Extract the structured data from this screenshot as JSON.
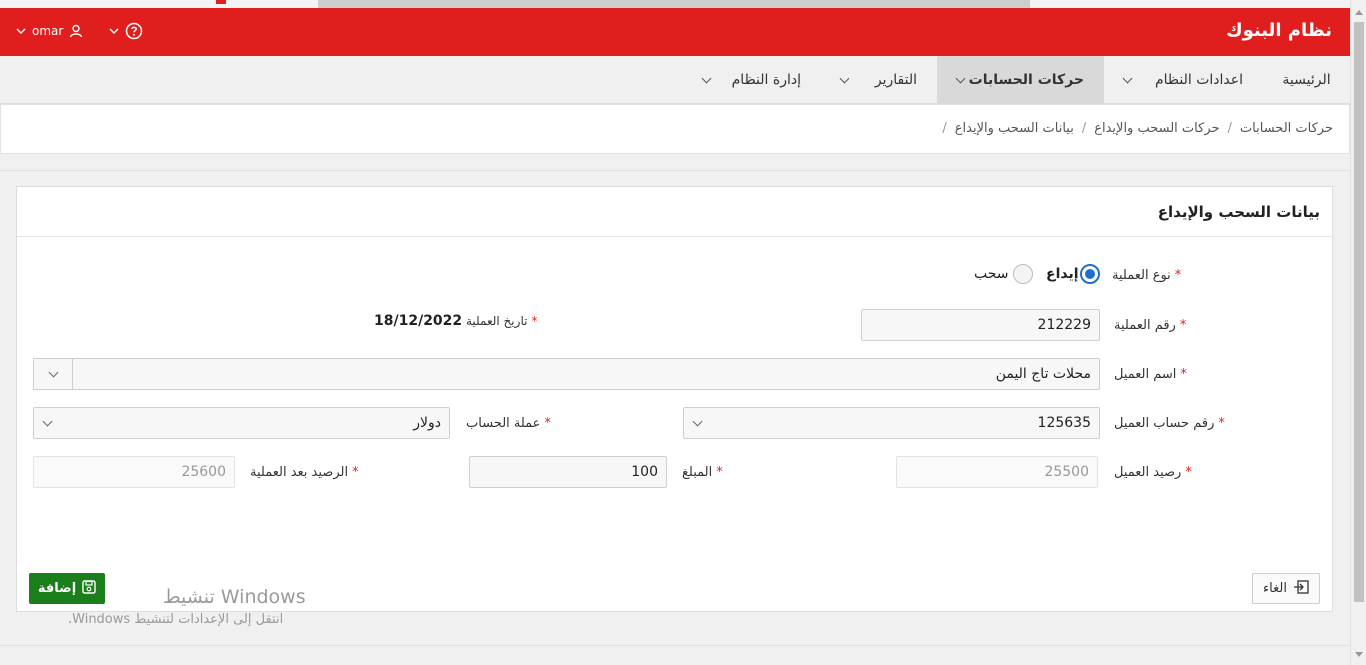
{
  "app": {
    "title": "نظام البنوك",
    "user_name": "omar",
    "colors": {
      "header": "#e01e1e",
      "primary_button": "#1a7f1a",
      "radio_selected": "#1f6fd0",
      "required": "#e01e1e"
    },
    "icons": {
      "help": "help-circle-icon",
      "user": "user-icon",
      "chevron": "chevron-down-icon"
    }
  },
  "menu": {
    "items": [
      {
        "label": "الرئيسية"
      },
      {
        "label": "اعدادات النظام"
      },
      {
        "label": "حركات الحسابات",
        "active": true
      },
      {
        "label": "التقارير"
      },
      {
        "label": "إدارة النظام"
      }
    ]
  },
  "breadcrumb": [
    "حركات الحسابات",
    "حركات السحب والإيداع",
    "بيانات السحب والإيداع"
  ],
  "breadcrumb_separator": "/",
  "form": {
    "title": "بيانات السحب والإيداع",
    "operation_type": {
      "label": "نوع العملية",
      "options": [
        "إيداع",
        "سحب"
      ],
      "selected": "إيداع"
    },
    "operation_number": {
      "label": "رقم العملية",
      "value": "212229"
    },
    "operation_date": {
      "label": "تاريخ العملية",
      "value": "18/12/2022"
    },
    "customer_name": {
      "label": "اسم العميل",
      "value": "محلات تاج اليمن"
    },
    "customer_account": {
      "label": "رقم حساب العميل",
      "value": "125635"
    },
    "account_currency": {
      "label": "عملة الحساب",
      "value": "دولار"
    },
    "customer_balance": {
      "label": "رصيد العميل",
      "value": "25500"
    },
    "amount": {
      "label": "المبلغ",
      "value": "100"
    },
    "balance_after": {
      "label": "الرصيد بعد العملية",
      "value": "25600"
    },
    "required_mark": "*"
  },
  "buttons": {
    "add": {
      "label": "إضافة",
      "icon": "save-icon"
    },
    "cancel": {
      "label": "الغاء",
      "icon": "exit-icon"
    }
  },
  "watermark": {
    "line1": "تنشيط Windows",
    "line2": "انتقل إلى الإعدادات لتنشيط Windows."
  }
}
